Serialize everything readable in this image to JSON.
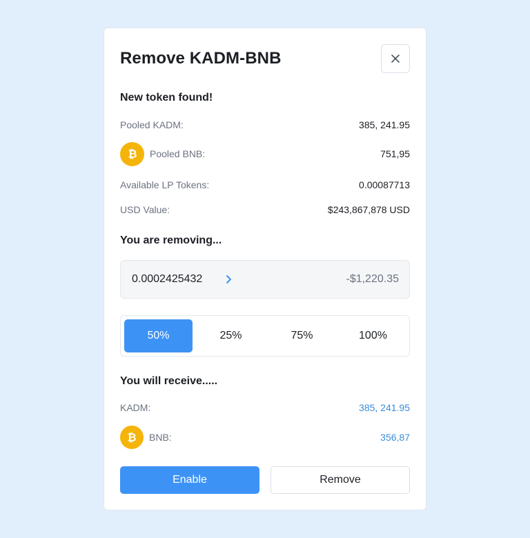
{
  "modal": {
    "title": "Remove KADM-BNB",
    "close_label": "×"
  },
  "pool": {
    "heading": "New token found!",
    "rows": [
      {
        "label": "Pooled KADM:",
        "value": "385, 241.95"
      },
      {
        "label": "Pooled BNB:",
        "value": "751,95",
        "icon": "bitcoin-icon"
      },
      {
        "label": "Available LP Tokens:",
        "value": "0.00087713"
      },
      {
        "label": "USD Value:",
        "value": "$243,867,878 USD"
      }
    ]
  },
  "removing": {
    "heading": "You are removing...",
    "amount": "0.0002425432",
    "usd": "-$1,220.35",
    "percentages": [
      "50%",
      "25%",
      "75%",
      "100%"
    ],
    "selected_percentage": "50%"
  },
  "receive": {
    "heading": "You will receive.....",
    "rows": [
      {
        "label": "KADM:",
        "value": "385, 241.95"
      },
      {
        "label": "BNB:",
        "value": "356,87",
        "icon": "bitcoin-icon"
      }
    ]
  },
  "actions": {
    "enable_label": "Enable",
    "remove_label": "Remove"
  },
  "colors": {
    "page_background": "#e1effd",
    "accent_blue": "#3d93f5",
    "value_blue": "#3a8ddb",
    "coin_gold": "#f5b40a"
  }
}
